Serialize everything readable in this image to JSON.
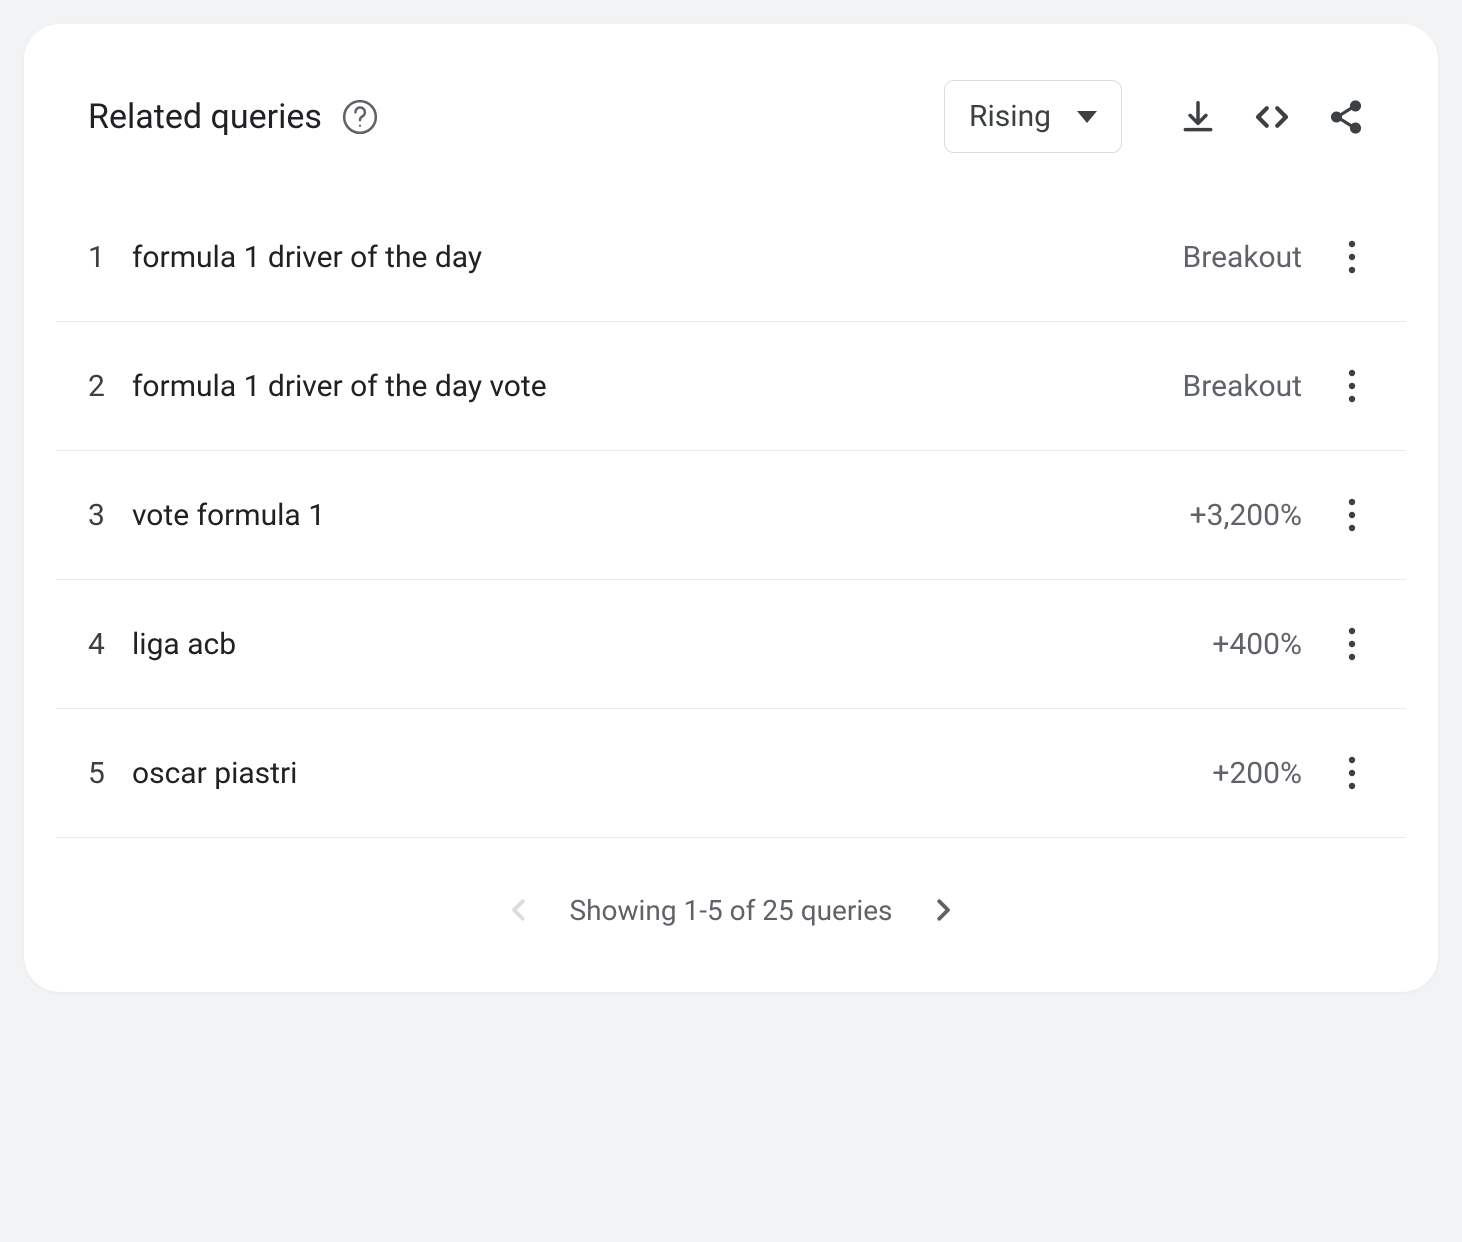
{
  "header": {
    "title": "Related queries",
    "dropdown_label": "Rising"
  },
  "queries": [
    {
      "rank": "1",
      "text": "formula 1 driver of the day",
      "value": "Breakout"
    },
    {
      "rank": "2",
      "text": "formula 1 driver of the day vote",
      "value": "Breakout"
    },
    {
      "rank": "3",
      "text": "vote formula 1",
      "value": "+3,200%"
    },
    {
      "rank": "4",
      "text": "liga acb",
      "value": "+400%"
    },
    {
      "rank": "5",
      "text": "oscar piastri",
      "value": "+200%"
    }
  ],
  "footer": {
    "text": "Showing 1-5 of 25 queries"
  }
}
